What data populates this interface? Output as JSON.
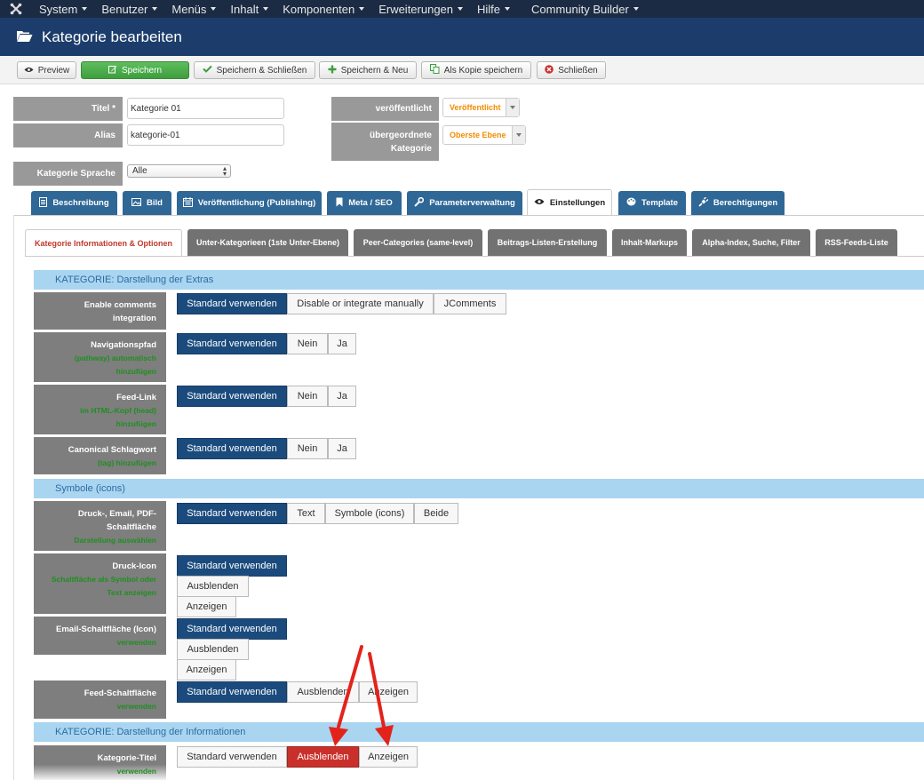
{
  "nav": {
    "items": [
      {
        "label": "System"
      },
      {
        "label": "Benutzer"
      },
      {
        "label": "Menüs"
      },
      {
        "label": "Inhalt"
      },
      {
        "label": "Komponenten"
      },
      {
        "label": "Erweiterungen"
      },
      {
        "label": "Hilfe"
      },
      {
        "label": "Community Builder"
      }
    ]
  },
  "header": {
    "title": "Kategorie bearbeiten"
  },
  "toolbar": {
    "preview": "Preview",
    "save": "Speichern",
    "save_close": "Speichern & Schließen",
    "save_new": "Speichern & Neu",
    "save_copy": "Als Kopie speichern",
    "close": "Schließen"
  },
  "form": {
    "title_label": "Titel *",
    "title_value": "Kategorie 01",
    "alias_label": "Alias",
    "alias_value": "kategorie-01",
    "language_label": "Kategorie Sprache",
    "language_value": "Alle",
    "published_label": "veröffentlicht",
    "published_value": "Veröffentlicht",
    "parent_label_1": "übergeordnete",
    "parent_label_2": "Kategorie",
    "parent_value": "Oberste Ebene"
  },
  "tabs": [
    {
      "label": "Beschreibung",
      "icon": "document-icon"
    },
    {
      "label": "Bild",
      "icon": "image-icon"
    },
    {
      "label": "Veröffentlichung (Publishing)",
      "icon": "calendar-icon"
    },
    {
      "label": "Meta / SEO",
      "icon": "bookmark-icon"
    },
    {
      "label": "Parameterverwaltung",
      "icon": "wrench-icon"
    },
    {
      "label": "Einstellungen",
      "icon": "eye-icon"
    },
    {
      "label": "Template",
      "icon": "palette-icon"
    },
    {
      "label": "Berechtigungen",
      "icon": "plug-icon"
    }
  ],
  "subtabs": [
    "Kategorie Informationen & Optionen",
    "Unter-Kategorieen (1ste Unter-Ebene)",
    "Peer-Categories (same-level)",
    "Beitrags-Listen-Erstellung",
    "Inhalt-Markups",
    "Alpha-Index, Suche, Filter",
    "RSS-Feeds-Liste"
  ],
  "sections": {
    "extras": "KATEGORIE: Darstellung der Extras",
    "icons": "Symbole (icons)",
    "info": "KATEGORIE: Darstellung der Informationen"
  },
  "params": {
    "comments": {
      "l1": "Enable comments",
      "l2": "integration",
      "opts": [
        "Standard verwenden",
        "Disable or integrate manually",
        "JComments"
      ]
    },
    "pathway": {
      "l1": "Navigationspfad",
      "sub1": "(pathway) automatisch",
      "sub2": "hinzufügen",
      "opts": [
        "Standard verwenden",
        "Nein",
        "Ja"
      ]
    },
    "feedlink": {
      "l1": "Feed-Link",
      "sub1": "im HTML-Kopf (head)",
      "sub2": "hinzufügen",
      "opts": [
        "Standard verwenden",
        "Nein",
        "Ja"
      ]
    },
    "canonical": {
      "l1": "Canonical Schlagwort",
      "sub1": "(tag) hinzufügen",
      "opts": [
        "Standard verwenden",
        "Nein",
        "Ja"
      ]
    },
    "printemail": {
      "l1": "Druck-, Email, PDF-",
      "l2": "Schaltfläche",
      "sub1": "Darstellung auswählen",
      "opts": [
        "Standard verwenden",
        "Text",
        "Symbole (icons)",
        "Beide"
      ]
    },
    "printicon": {
      "l1": "Druck-Icon",
      "sub1": "Schaltfläche als Symbol oder",
      "sub2": "Text anzeigen",
      "opts": [
        "Standard verwenden",
        "Ausblenden",
        "Anzeigen"
      ]
    },
    "emailicon": {
      "l1": "Email-Schaltfläche (Icon)",
      "sub1": "verwenden",
      "opts": [
        "Standard verwenden",
        "Ausblenden",
        "Anzeigen"
      ]
    },
    "feedbtn": {
      "l1": "Feed-Schaltfläche",
      "sub1": "verwenden",
      "opts": [
        "Standard verwenden",
        "Ausblenden",
        "Anzeigen"
      ]
    },
    "cattitle": {
      "l1": "Kategorie-Titel",
      "sub1": "verwenden",
      "opts": [
        "Standard verwenden",
        "Ausblenden",
        "Anzeigen"
      ]
    }
  },
  "colors": {
    "navbar": "#1b2b44",
    "titlebar": "#1c3d6b",
    "active_button": "#1b4b7d",
    "danger_button": "#c9302c",
    "annotation_arrow": "#e3231b"
  }
}
